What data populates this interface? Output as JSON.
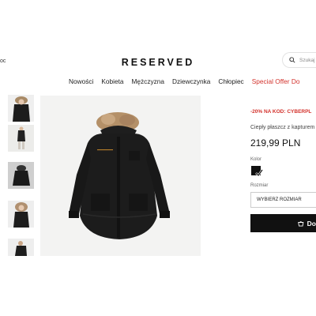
{
  "header": {
    "help_text": "oc",
    "logo_text": "RESERVED",
    "search_placeholder": "Szukaj"
  },
  "nav": {
    "items": [
      "Nowości",
      "Kobieta",
      "Mężczyzna",
      "Dziewczynka",
      "Chłopiec"
    ],
    "special": "Special Offer Do"
  },
  "gallery": {
    "thumbnails": [
      "coat-front-worn",
      "coat-full-body",
      "coat-front-flat",
      "coat-hood-worn",
      "coat-side-worn"
    ]
  },
  "product": {
    "promo": "-20% NA KOD: CYBERPL",
    "title": "Ciepły płaszcz z kapturem",
    "price": "219,99 PLN",
    "color_label": "Kolor",
    "selected_color": "#111111",
    "size_label": "Rozmiar",
    "size_placeholder": "WYBIERZ ROZMIAR",
    "add_button_label": "Do k"
  },
  "colors": {
    "sale_red": "#d3322c",
    "button_black": "#111111"
  }
}
